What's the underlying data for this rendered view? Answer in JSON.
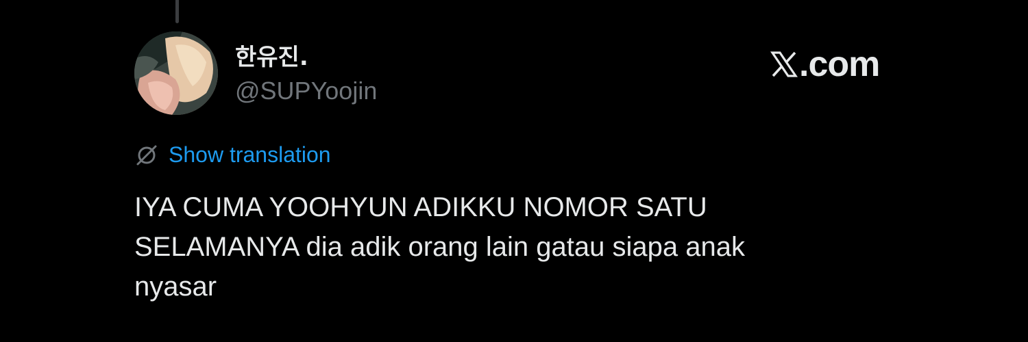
{
  "author": {
    "display_name": "한유진.",
    "handle": "@SUPYoojin"
  },
  "brand": {
    "site": ".com",
    "logo_icon": "x-logo-icon"
  },
  "translation": {
    "icon": "globe-icon",
    "link_label": "Show translation"
  },
  "tweet": {
    "lines": [
      "IYA CUMA YOOHYUN ADIKKU NOMOR SATU",
      "SELAMANYA dia adik orang lain gatau siapa anak",
      "nyasar"
    ]
  },
  "colors": {
    "background": "#000000",
    "primary_text": "#e7e9ea",
    "secondary_text": "#71767b",
    "link": "#1d9bf0"
  }
}
